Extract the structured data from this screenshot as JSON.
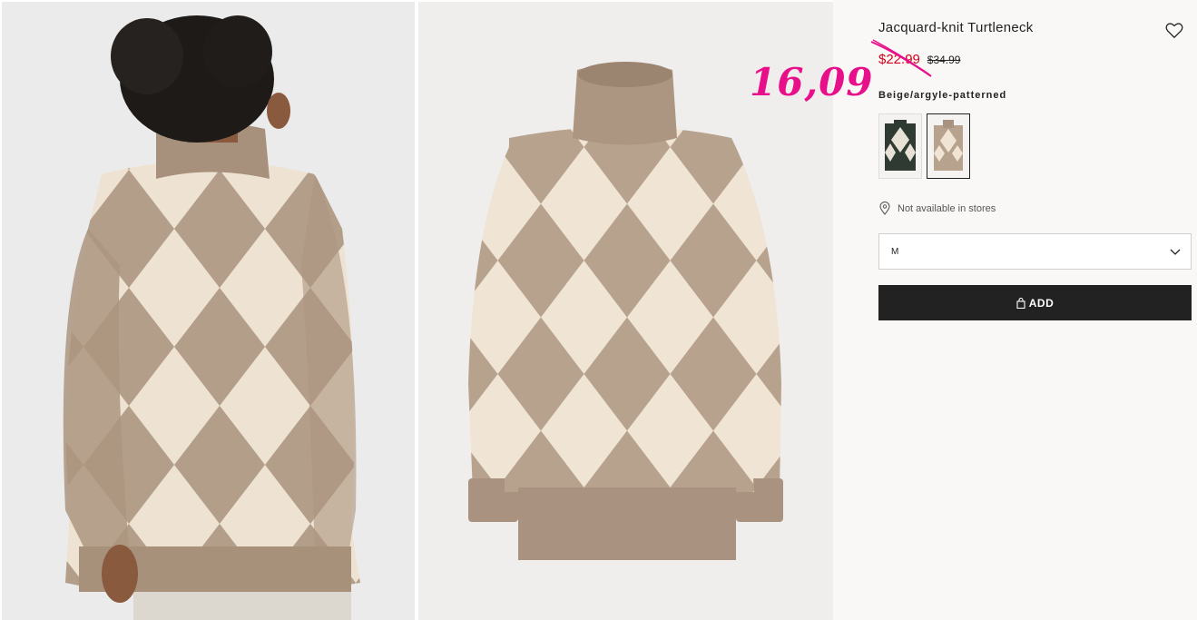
{
  "product": {
    "title": "Jacquard-knit Turtleneck",
    "sale_price": "$22.99",
    "original_price": "$34.99",
    "handwritten_note": "16,09",
    "color_name": "Beige/argyle-patterned",
    "availability": "Not available in stores",
    "size_selected": "M",
    "add_label": "ADD"
  },
  "images": {
    "model_photo": "woman wearing beige argyle turtleneck, back view",
    "product_photo": "beige argyle jacquard-knit turtleneck sweater"
  },
  "swatches": [
    {
      "name": "dark green argyle",
      "selected": false
    },
    {
      "name": "beige argyle",
      "selected": true
    }
  ],
  "colors": {
    "sale_red": "#d6001c",
    "note_pink": "#e8108a",
    "button_dark": "#222222",
    "sweater_taupe": "#b09a86",
    "sweater_cream": "#efe4d3"
  },
  "icons": [
    "heart-icon",
    "location-pin-icon",
    "chevron-down-icon",
    "shopping-bag-icon"
  ]
}
